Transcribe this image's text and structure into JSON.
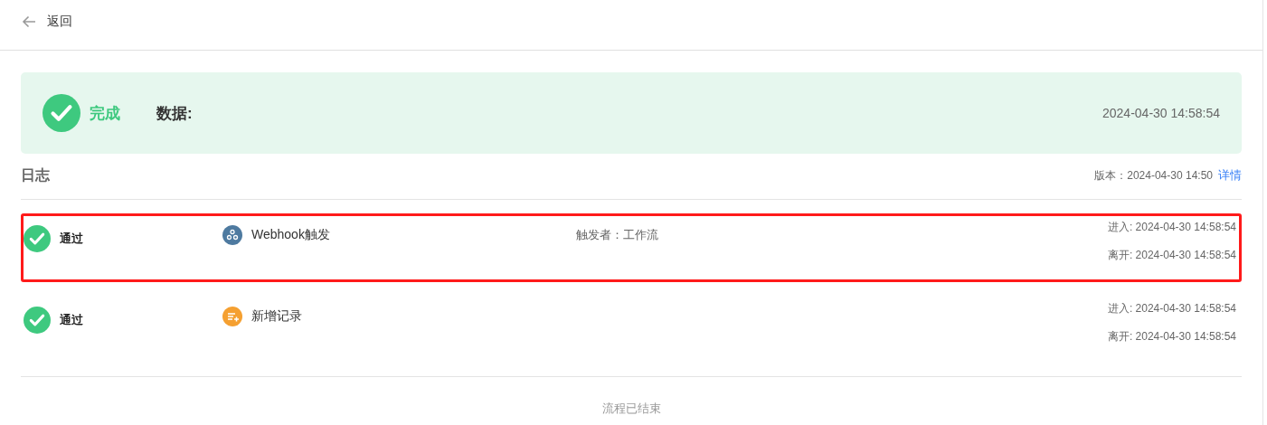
{
  "header": {
    "back_label": "返回"
  },
  "summary": {
    "status": "完成",
    "done": true,
    "data_label": "数据:",
    "time": "2024-04-30 14:58:54"
  },
  "log": {
    "title": "日志",
    "version": "版本：2024-04-30 14:50",
    "details_link": "详情",
    "rows": [
      {
        "status": "通过",
        "passed": true,
        "highlighted": true,
        "node": {
          "kind": "webhook",
          "name": "Webhook触发"
        },
        "trigger": "触发者：工作流",
        "enter": "进入: 2024-04-30 14:58:54",
        "leave": "离开: 2024-04-30 14:58:54"
      },
      {
        "status": "通过",
        "passed": true,
        "highlighted": false,
        "node": {
          "kind": "add_record",
          "name": "新增记录"
        },
        "enter": "进入: 2024-04-30 14:58:54",
        "leave": "离开: 2024-04-30 14:58:54"
      }
    ]
  },
  "footer": "流程已结束"
}
